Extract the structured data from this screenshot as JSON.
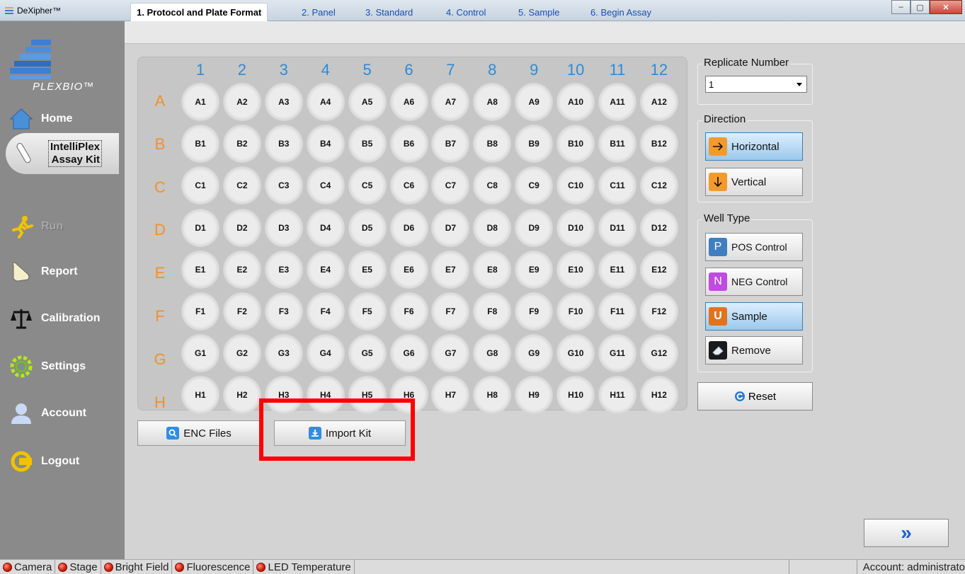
{
  "window": {
    "title": "DeXipher™",
    "minimize": "–",
    "maximize": "▢",
    "close": "✕"
  },
  "logo": {
    "text": "PLEXBIO™"
  },
  "sidebar": {
    "items": [
      {
        "label": "Home"
      },
      {
        "label": "IntelliPlex\nAssay Kit"
      },
      {
        "label": "Run"
      },
      {
        "label": "Report"
      },
      {
        "label": "Calibration"
      },
      {
        "label": "Settings"
      },
      {
        "label": "Account"
      },
      {
        "label": "Logout"
      }
    ]
  },
  "tabs": [
    {
      "label": "1. Protocol and Plate Format"
    },
    {
      "label": "2. Panel"
    },
    {
      "label": "3. Standard"
    },
    {
      "label": "4. Control"
    },
    {
      "label": "5. Sample"
    },
    {
      "label": "6. Begin Assay"
    }
  ],
  "plate": {
    "columns": [
      "1",
      "2",
      "3",
      "4",
      "5",
      "6",
      "7",
      "8",
      "9",
      "10",
      "11",
      "12"
    ],
    "rows": [
      "A",
      "B",
      "C",
      "D",
      "E",
      "F",
      "G",
      "H"
    ]
  },
  "buttons": {
    "enc_files": "ENC Files",
    "import_kit": "Import Kit",
    "reset": "Reset",
    "next": "»"
  },
  "replicate": {
    "label": "Replicate Number",
    "value": "1"
  },
  "direction": {
    "label": "Direction",
    "horizontal": "Horizontal",
    "vertical": "Vertical"
  },
  "well_type": {
    "label": "Well Type",
    "pos": "POS Control",
    "pos_letter": "P",
    "neg": "NEG Control",
    "neg_letter": "N",
    "sample": "Sample",
    "sample_letter": "U",
    "remove": "Remove"
  },
  "status": {
    "items": [
      "Camera",
      "Stage",
      "Bright Field",
      "Fluorescence",
      "LED Temperature"
    ],
    "account": "Account: administrato"
  },
  "colors": {
    "col_header": "#2e8bd6",
    "row_header": "#f0912a",
    "highlight": "#ff0000",
    "pos": "#3f7fbf",
    "neg": "#c04be0",
    "sample": "#e0741c"
  }
}
